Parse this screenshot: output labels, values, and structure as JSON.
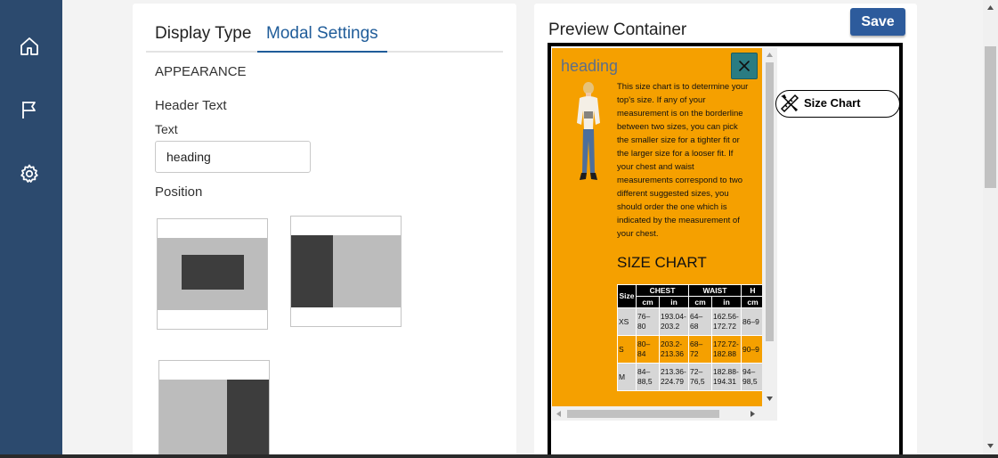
{
  "sidebar": {
    "items": [
      {
        "icon": "home-icon"
      },
      {
        "icon": "flag-icon"
      },
      {
        "icon": "gear-icon"
      }
    ]
  },
  "settings": {
    "tabs": [
      {
        "label": "Display Type",
        "active": false
      },
      {
        "label": "Modal Settings",
        "active": true
      }
    ],
    "section_title": "APPEARANCE",
    "header_text_label": "Header Text",
    "text_label": "Text",
    "text_value": "heading",
    "position_label": "Position",
    "position_options": [
      "center",
      "left",
      "right"
    ]
  },
  "preview": {
    "title": "Preview Container",
    "save_label": "Save",
    "modal": {
      "heading": "heading",
      "close_icon": "close-icon",
      "description": "This size chart is to determine your top's size. If any of your measurement is on the borderline between two sizes, you can pick the smaller size for a tighter fit or the larger size for a looser fit. If your chest and waist measurements correspond to two different suggested sizes, you should order the one which is indicated by the measurement of your chest.",
      "chart_heading": "SIZE CHART",
      "table": {
        "size_header": "Size",
        "group_headers": [
          "CHEST",
          "WAIST",
          "H"
        ],
        "unit_headers": [
          "cm",
          "in",
          "cm",
          "in",
          "cm"
        ],
        "rows": [
          {
            "size": "XS",
            "cells": [
              "76–80",
              "193.04-203.2",
              "64–68",
              "162.56-172.72",
              "86–9"
            ]
          },
          {
            "size": "S",
            "cells": [
              "80–84",
              "203.2-213.36",
              "68–72",
              "172.72-182.88",
              "90–9"
            ]
          },
          {
            "size": "M",
            "cells": [
              "84–88,5",
              "213.36-224.79",
              "72–76,5",
              "182.88-194.31",
              "94–98,5"
            ]
          }
        ]
      }
    },
    "size_chart_button": {
      "label": "Size Chart",
      "icon": "ruler-pencil-icon"
    }
  },
  "colors": {
    "sidebar": "#2c4a6e",
    "accent": "#1f5c99",
    "save_button": "#2d5b9c",
    "modal_bg": "#f5a000",
    "close_button": "#2a7c82"
  }
}
